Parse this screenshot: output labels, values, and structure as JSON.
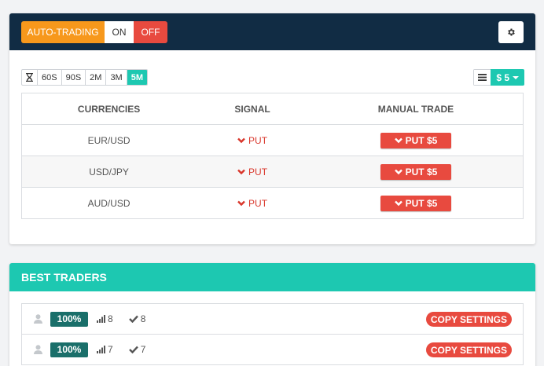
{
  "topbar": {
    "auto_label": "AUTO-TRADING",
    "on_label": "ON",
    "off_label": "OFF",
    "settings_icon": "gear-icon"
  },
  "timeframes": {
    "icon": "hourglass-icon",
    "items": [
      "60S",
      "90S",
      "2M",
      "3M",
      "5M"
    ],
    "active": "5M"
  },
  "amount": {
    "menu_icon": "list-icon",
    "value": "$ 5"
  },
  "signals": {
    "headers": [
      "CURRENCIES",
      "SIGNAL",
      "MANUAL TRADE"
    ],
    "rows": [
      {
        "pair": "EUR/USD",
        "signal": "PUT",
        "trade": "PUT $5"
      },
      {
        "pair": "USD/JPY",
        "signal": "PUT",
        "trade": "PUT $5"
      },
      {
        "pair": "AUD/USD",
        "signal": "PUT",
        "trade": "PUT $5"
      }
    ]
  },
  "best_traders": {
    "title": "BEST TRADERS",
    "rows": [
      {
        "percent": "100%",
        "trades": "8",
        "wins": "8",
        "button": "COPY SETTINGS"
      },
      {
        "percent": "100%",
        "trades": "7",
        "wins": "7",
        "button": "COPY SETTINGS"
      }
    ]
  },
  "colors": {
    "navy": "#112c44",
    "orange": "#f7981c",
    "red": "#e84a3f",
    "teal": "#1dc8b1",
    "dark_teal": "#1a6f6a"
  }
}
